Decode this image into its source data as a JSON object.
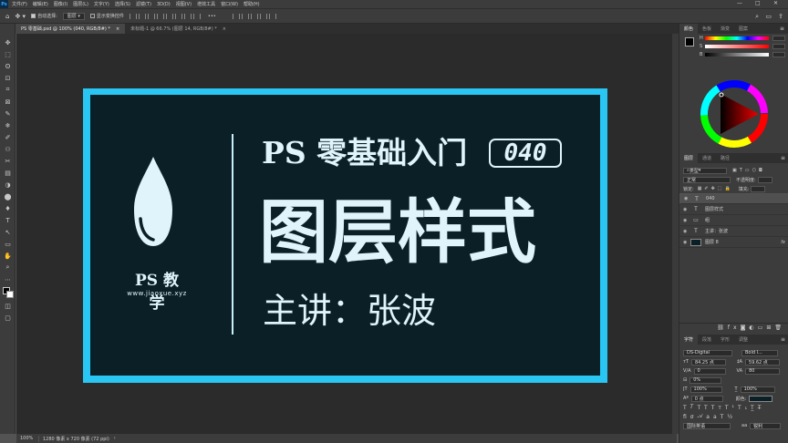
{
  "app": {
    "logo": "Ps"
  },
  "menu": [
    "文件(F)",
    "编辑(E)",
    "图像(I)",
    "图层(L)",
    "文字(Y)",
    "选择(S)",
    "滤镜(T)",
    "3D(D)",
    "视图(V)",
    "增效工具",
    "窗口(W)",
    "帮助(H)"
  ],
  "window_controls": {
    "minimize": "—",
    "maximize": "□",
    "close": "✕"
  },
  "options": {
    "auto_select_label": "自动选择:",
    "auto_select_value": "图层",
    "transform_label": "显示变换控件",
    "more": "•••"
  },
  "tabs": [
    {
      "label": "PS 零基础.psd @ 100% (040, RGB/8#) *",
      "close": "×"
    },
    {
      "label": "未标题-1 @ 66.7% (图层 14, RGB/8#) *",
      "close": "×"
    }
  ],
  "tools": [
    "✥",
    "⬚",
    "ʘ",
    "⊡",
    "⌗",
    "⊠",
    "✎",
    "❄",
    "✐",
    "⚇",
    "✂",
    "▤",
    "◑",
    "⬤",
    "♦",
    "T",
    "↖",
    "▭",
    "✋",
    "⌕",
    "⋯"
  ],
  "canvas": {
    "logo_text": "PS 教学",
    "logo_url": "www.jiaoxue.xyz",
    "heading": "PS 零基础入门",
    "badge": "040",
    "title": "图层样式",
    "lecturer": "主讲：张波"
  },
  "status": {
    "zoom": "100%",
    "doc": "1280 像素 x 720 像素 (72 ppi)",
    "arrow": "›"
  },
  "panels": {
    "color_tabs": [
      "颜色",
      "色板",
      "渐变",
      "图案"
    ],
    "sliders": [
      {
        "label": "H",
        "value": ""
      },
      {
        "label": "S",
        "value": ""
      },
      {
        "label": "B",
        "value": ""
      }
    ],
    "layers_tabs": [
      "图层",
      "通道",
      "路径"
    ],
    "filter_kind": "类型",
    "blend_mode": "正常",
    "opacity_label": "不透明度:",
    "lock_label": "锁定:",
    "fill_label": "填充:",
    "layers": [
      {
        "name": "040",
        "thumb": "T"
      },
      {
        "name": "图层样式",
        "thumb": "T"
      },
      {
        "name": "组",
        "thumb": "▭"
      },
      {
        "name": "主讲：张波",
        "thumb": "T"
      },
      {
        "name": "图层 8",
        "thumb": ""
      }
    ],
    "layer_fx": "fx",
    "char_tabs": [
      "字符",
      "段落",
      "字形",
      "调整"
    ],
    "font_family": "DS-Digital",
    "font_style": "Bold I...",
    "font_size": "84.25 点",
    "leading": "59.62 点",
    "kerning": "0",
    "tracking": "80",
    "tsume": "0%",
    "v_scale": "100%",
    "h_scale": "100%",
    "baseline": "0 点",
    "color_label": "颜色:",
    "language": "国际英语",
    "aa_label": "aa",
    "aa_value": "锐利"
  },
  "colors": {
    "accent": "#29c5f3",
    "bg": "#0b2026",
    "text": "#dff4fb"
  }
}
